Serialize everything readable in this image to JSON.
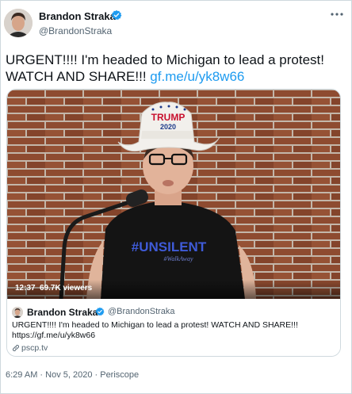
{
  "author": {
    "display_name": "Brandon Straka",
    "handle": "@BrandonStraka"
  },
  "tweet": {
    "text": "URGENT!!!! I'm headed to Michigan to lead a protest! WATCH AND SHARE!!! ",
    "link_text": "gf.me/u/yk8w66"
  },
  "video": {
    "duration": "12:37",
    "viewers": "69.7K viewers",
    "hat_brand": "TRUMP",
    "hat_year": "2020",
    "shirt_text": "#UNSILENT",
    "shirt_subtext": "#WalkAway"
  },
  "quote": {
    "display_name": "Brandon Straka",
    "handle": "@BrandonStraka",
    "text": "URGENT!!!! I'm headed to Michigan to lead a protest! WATCH AND SHARE!!! https://gf.me/u/yk8w66",
    "link_domain": "pscp.tv"
  },
  "meta": {
    "line": "6:29 AM · Nov 5, 2020 · Periscope"
  },
  "colors": {
    "accent": "#1d9bf0",
    "muted": "#536471",
    "text": "#0f1419",
    "brick": "#9a5236"
  },
  "icons": [
    "verified-badge-icon",
    "more-options-icon",
    "link-icon"
  ]
}
